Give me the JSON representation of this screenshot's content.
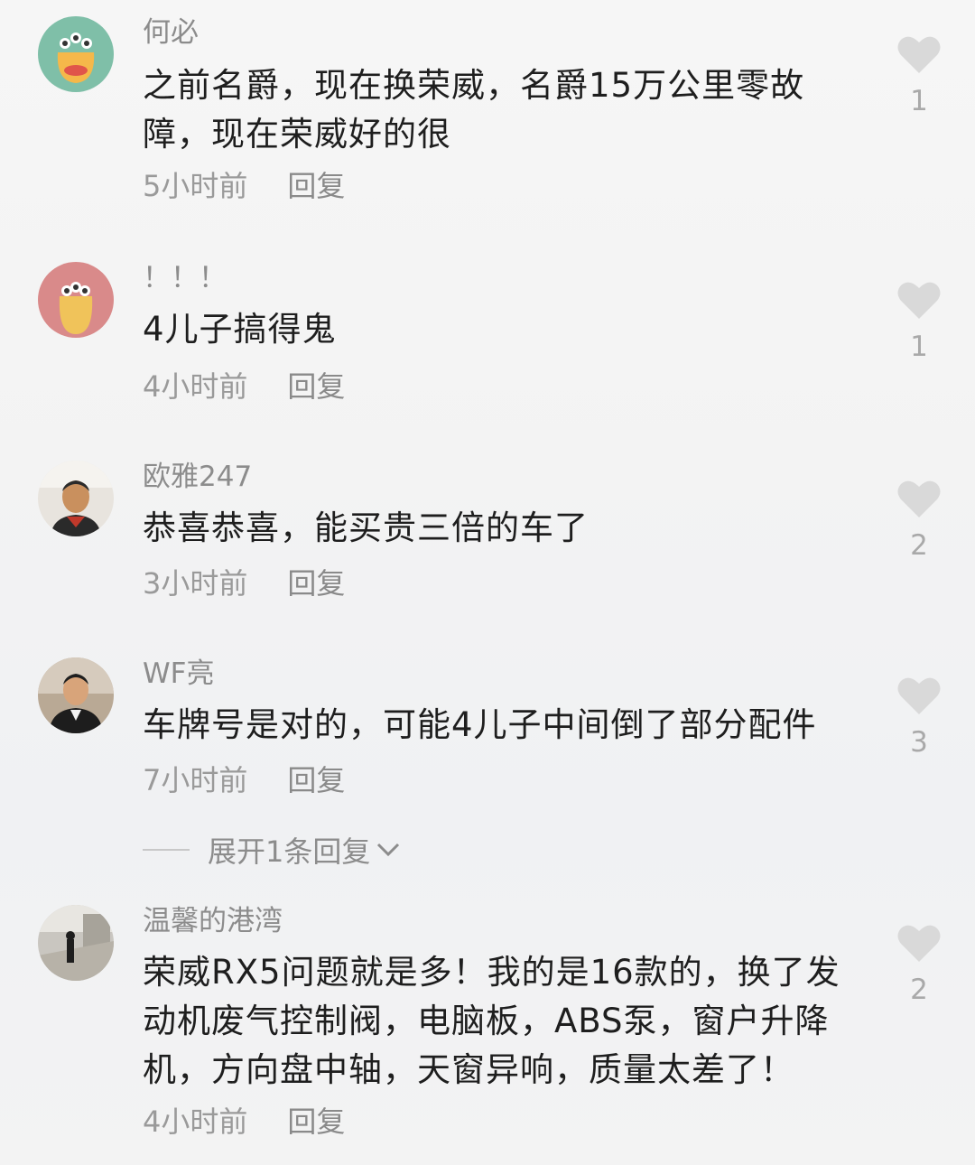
{
  "comments": [
    {
      "username": "何必",
      "content": "之前名爵，现在换荣威，名爵15万公里零故障，现在荣威好的很",
      "time": "5小时前",
      "reply": "回复",
      "likes": "1"
    },
    {
      "username": "！！！",
      "content": "4儿子搞得鬼",
      "time": "4小时前",
      "reply": "回复",
      "likes": "1"
    },
    {
      "username": "欧雅247",
      "content": "恭喜恭喜，能买贵三倍的车了",
      "time": "3小时前",
      "reply": "回复",
      "likes": "2"
    },
    {
      "username": "WF亮",
      "content": "车牌号是对的，可能4儿子中间倒了部分配件",
      "time": "7小时前",
      "reply": "回复",
      "likes": "3"
    },
    {
      "username": "温馨的港湾",
      "content": "荣威RX5问题就是多！我的是16款的，换了发动机废气控制阀，电脑板，ABS泵，窗户升降机，方向盘中轴，天窗异响，质量太差了！",
      "time": "4小时前",
      "reply": "回复",
      "likes": "2"
    }
  ],
  "expand_replies": "展开1条回复",
  "icons": {
    "like": "heart-icon",
    "expand": "chevron-down-icon"
  },
  "colors": {
    "like": "#d9d9d9",
    "text": "#1e1e1e",
    "muted": "#8c8c8c"
  }
}
